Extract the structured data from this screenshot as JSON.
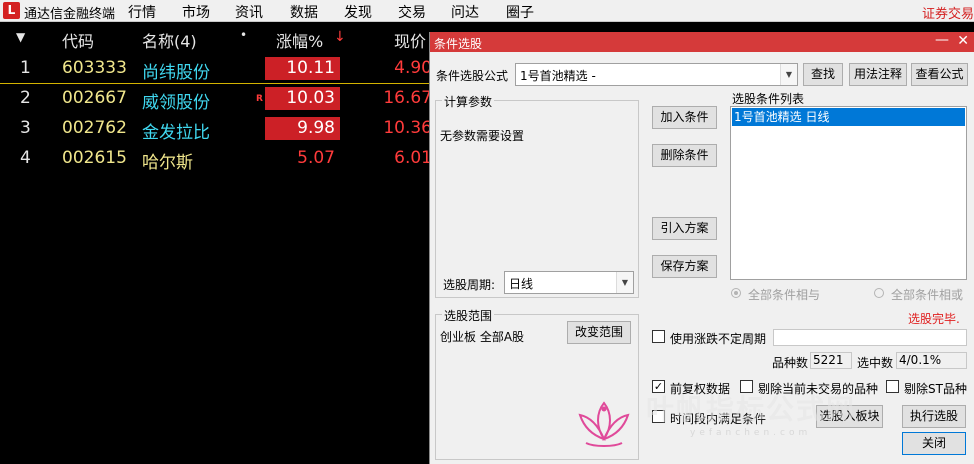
{
  "app": {
    "logo_char": "L",
    "title": "通达信金融终端",
    "menu": [
      "行情",
      "市场",
      "资讯",
      "数据",
      "发现",
      "交易",
      "问达",
      "圈子"
    ],
    "right_link": "证券交易"
  },
  "quote_table": {
    "headers": {
      "code": "代码",
      "name": "名称(4)",
      "dot": "•",
      "pct": "涨幅%",
      "sort_arrow": "↓",
      "price": "现价"
    },
    "rows": [
      {
        "idx": "1",
        "code": "603333",
        "name": "尚纬股份",
        "pct": "10.11",
        "price": "4.90",
        "badge": ""
      },
      {
        "idx": "2",
        "code": "002667",
        "name": "威领股份",
        "pct": "10.03",
        "price": "16.67",
        "badge": "R"
      },
      {
        "idx": "3",
        "code": "002762",
        "name": "金发拉比",
        "pct": "9.98",
        "price": "10.36",
        "badge": ""
      },
      {
        "idx": "4",
        "code": "002615",
        "name": "哈尔斯",
        "pct": "5.07",
        "price": "6.01",
        "badge": ""
      }
    ]
  },
  "dialog": {
    "title": "条件选股",
    "min_glyph": "—",
    "close_glyph": "✕",
    "formula_label": "条件选股公式",
    "formula_value": "1号首池精选  -",
    "btn_find": "查找",
    "btn_usage": "用法注释",
    "btn_view": "查看公式",
    "params_title": "计算参数",
    "params_text": "无参数需要设置",
    "period_label": "选股周期:",
    "period_value": "日线",
    "btn_add": "加入条件",
    "btn_delete": "删除条件",
    "btn_import": "引入方案",
    "btn_save": "保存方案",
    "list_title": "选股条件列表",
    "list_items": [
      "1号首池精选  日线"
    ],
    "radio_and": "全部条件相与",
    "radio_or": "全部条件相或",
    "status": "选股完毕.",
    "range_title": "选股范围",
    "range_text": "创业板 全部A股",
    "btn_change_range": "改变范围",
    "chk_volatility": "使用涨跌不定周期",
    "count_label": "品种数",
    "count_value": "5221",
    "selected_label": "选中数",
    "selected_value": "4/0.1%",
    "chk_adjust": "前复权数据",
    "chk_adjust_checked": true,
    "chk_exclude_untraded": "剔除当前未交易的品种",
    "chk_exclude_st": "剔除ST品种",
    "chk_time_range": "时间段内满足条件",
    "btn_to_block": "选股入板块",
    "btn_run": "执行选股",
    "btn_close": "关闭",
    "watermark": "叶帆指标公式网",
    "watermark_url": "yefanchen.com"
  }
}
